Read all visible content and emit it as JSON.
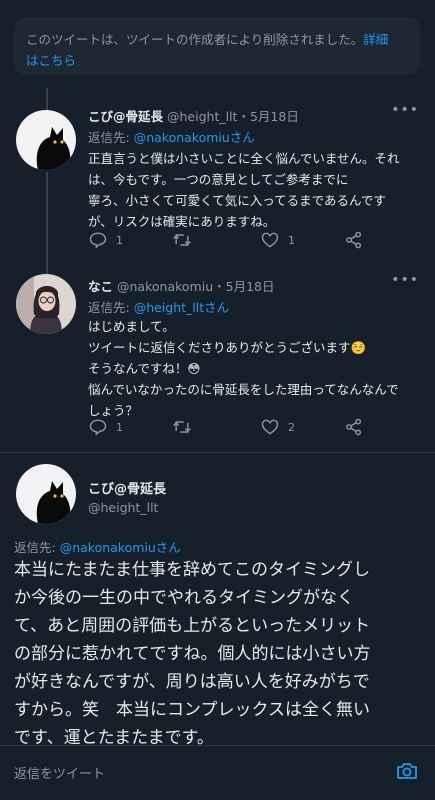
{
  "notice": {
    "text": "このツイートは、ツイートの作成者により削除されました。",
    "link": "詳細",
    "link2": "はこちら"
  },
  "tweets": [
    {
      "name": "こび@骨延長",
      "handle": "@height_llt",
      "sep": "・",
      "date": "5月18日",
      "reply_label": "返信先: ",
      "reply_to": "@nakonakomiuさん",
      "text": "正直言うと僕は小さいことに全く悩んでいません。それは、今もです。一つの意見としてご参考までに\n寧ろ、小さくて可愛くて気に入ってるまであるんです\nが、リスクは確実にありますね。",
      "reply_count": "1",
      "retweet_count": "",
      "like_count": "1"
    },
    {
      "name": "なこ",
      "handle": "@nakonakomiu",
      "sep": "・",
      "date": "5月18日",
      "reply_label": "返信先: ",
      "reply_to": "@height_lltさん",
      "text": "はじめまして。\nツイートに返信くださりありがとうございます☺️\nそうなんですね！😳\n悩んでいなかったのに骨延長をした理由ってなんなんで\nしょう？",
      "reply_count": "1",
      "retweet_count": "",
      "like_count": "2"
    }
  ],
  "main_tweet": {
    "name": "こび@骨延長",
    "handle": "@height_llt",
    "reply_label": "返信先: ",
    "reply_to": "@nakonakomiuさん",
    "text": "本当にたまたま仕事を辞めてこのタイミングし\nか今後の一生の中でやれるタイミングがなく\nて、あと周囲の評価も上がるといったメリット\nの部分に惹かれてですね。個人的には小さい方\nが好きなんですが、周りは高い人を好みがちで\nすから。笑　本当にコンプレックスは全く無い\nです、運とたまたまです。"
  },
  "composer": {
    "placeholder": "返信をツイート"
  },
  "colors": {
    "background": "#15202b",
    "accent": "#1d9bf0",
    "muted": "#8b98a5",
    "text": "#e7e9ea"
  },
  "icons": [
    "reply-icon",
    "retweet-icon",
    "like-icon",
    "share-icon",
    "more-icon",
    "camera-icon"
  ]
}
